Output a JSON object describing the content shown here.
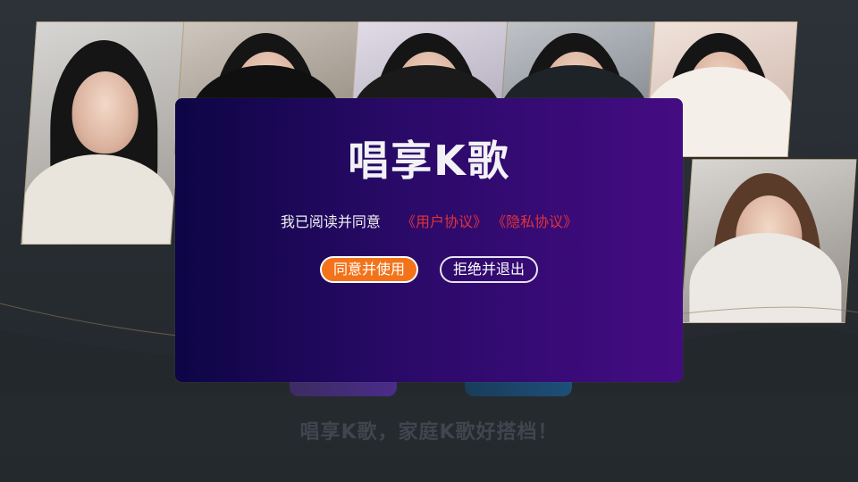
{
  "background": {
    "slogan": "唱享K歌，家庭K歌好搭档！"
  },
  "dialog": {
    "title": "唱享K歌",
    "consent_text": "我已阅读并同意",
    "user_agreement": "《用户协议》",
    "privacy_policy": "《隐私协议》",
    "agree_button": "同意并使用",
    "refuse_button": "拒绝并退出"
  },
  "colors": {
    "accent_orange": "#f3731b",
    "link_red": "#e0323b",
    "dialog_start": "#0d0545",
    "dialog_end": "#440c82"
  }
}
